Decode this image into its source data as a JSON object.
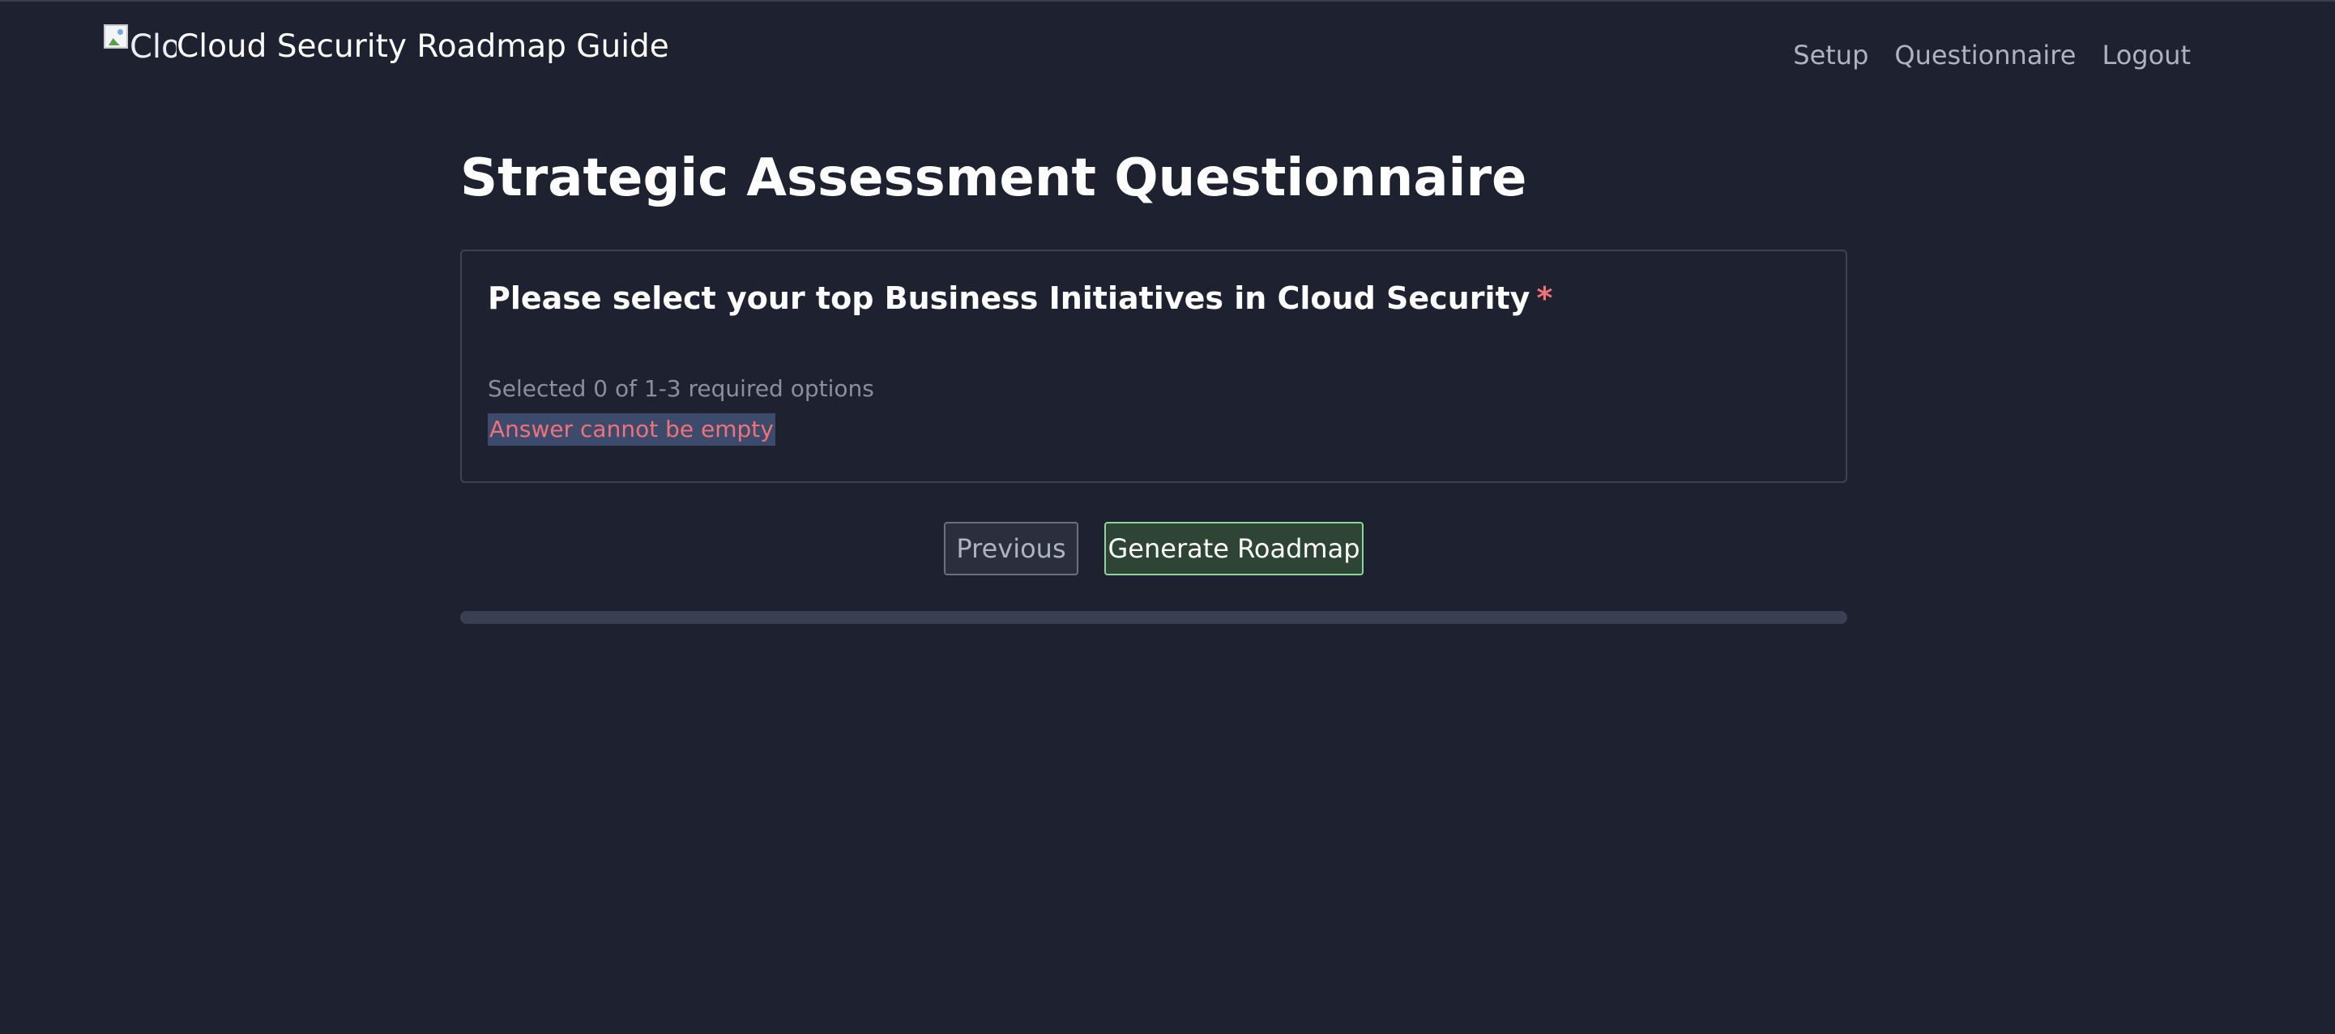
{
  "header": {
    "logo_alt": "Cloud Security Roadmap Guide",
    "app_title": "Cloud Security Roadmap Guide",
    "nav": [
      {
        "label": "Setup"
      },
      {
        "label": "Questionnaire"
      },
      {
        "label": "Logout"
      }
    ]
  },
  "main": {
    "page_title": "Strategic Assessment Questionnaire",
    "question": {
      "text": "Please select your top Business Initiatives in Cloud Security",
      "required_marker": "*",
      "selection_status": "Selected 0 of 1-3 required options",
      "error": "Answer cannot be empty"
    },
    "actions": {
      "previous_label": "Previous",
      "generate_label": "Generate Roadmap"
    },
    "progress": {
      "value": 0
    }
  },
  "colors": {
    "background": "#1e2130",
    "error": "#f07178",
    "primary_border": "#8fd39a"
  }
}
